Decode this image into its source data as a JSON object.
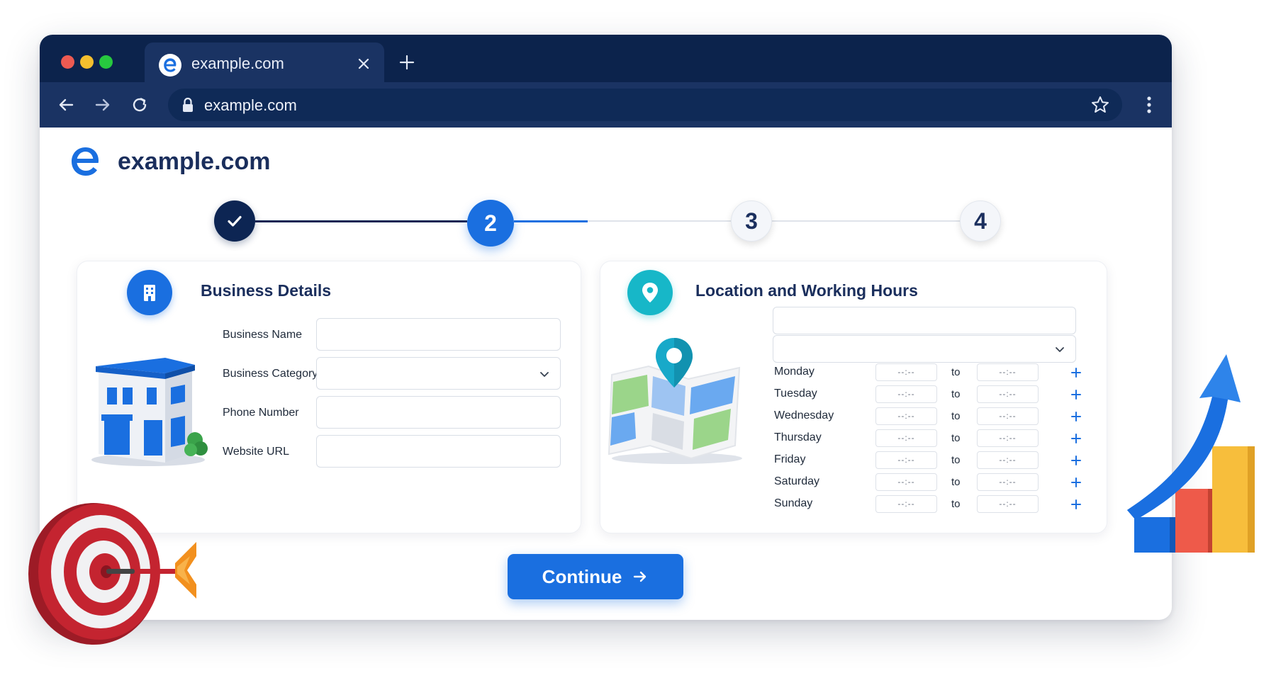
{
  "browser": {
    "tab_title": "example.com",
    "url": "example.com"
  },
  "site": {
    "name": "example.com"
  },
  "stepper": {
    "steps": [
      {
        "label": "",
        "state": "completed"
      },
      {
        "label": "2",
        "state": "active"
      },
      {
        "label": "3",
        "state": "upcoming"
      },
      {
        "label": "4",
        "state": "upcoming"
      }
    ]
  },
  "business": {
    "title": "Business Details",
    "fields": [
      {
        "label": "Business Name",
        "value": ""
      },
      {
        "label": "Business Category",
        "value": ""
      },
      {
        "label": "Phone Number",
        "value": ""
      },
      {
        "label": "Website URL",
        "value": ""
      }
    ]
  },
  "location": {
    "title": "Location and Working Hours",
    "address_value": "",
    "dropdown_value": "",
    "to_label": "to",
    "time_placeholder": "--:--",
    "days": [
      "Monday",
      "Tuesday",
      "Wednesday",
      "Thursday",
      "Friday",
      "Saturday",
      "Sunday"
    ]
  },
  "actions": {
    "continue_label": "Continue"
  },
  "colors": {
    "navy": "#0c234c",
    "primary_blue": "#1a6fe0",
    "teal": "#17b7c8"
  }
}
